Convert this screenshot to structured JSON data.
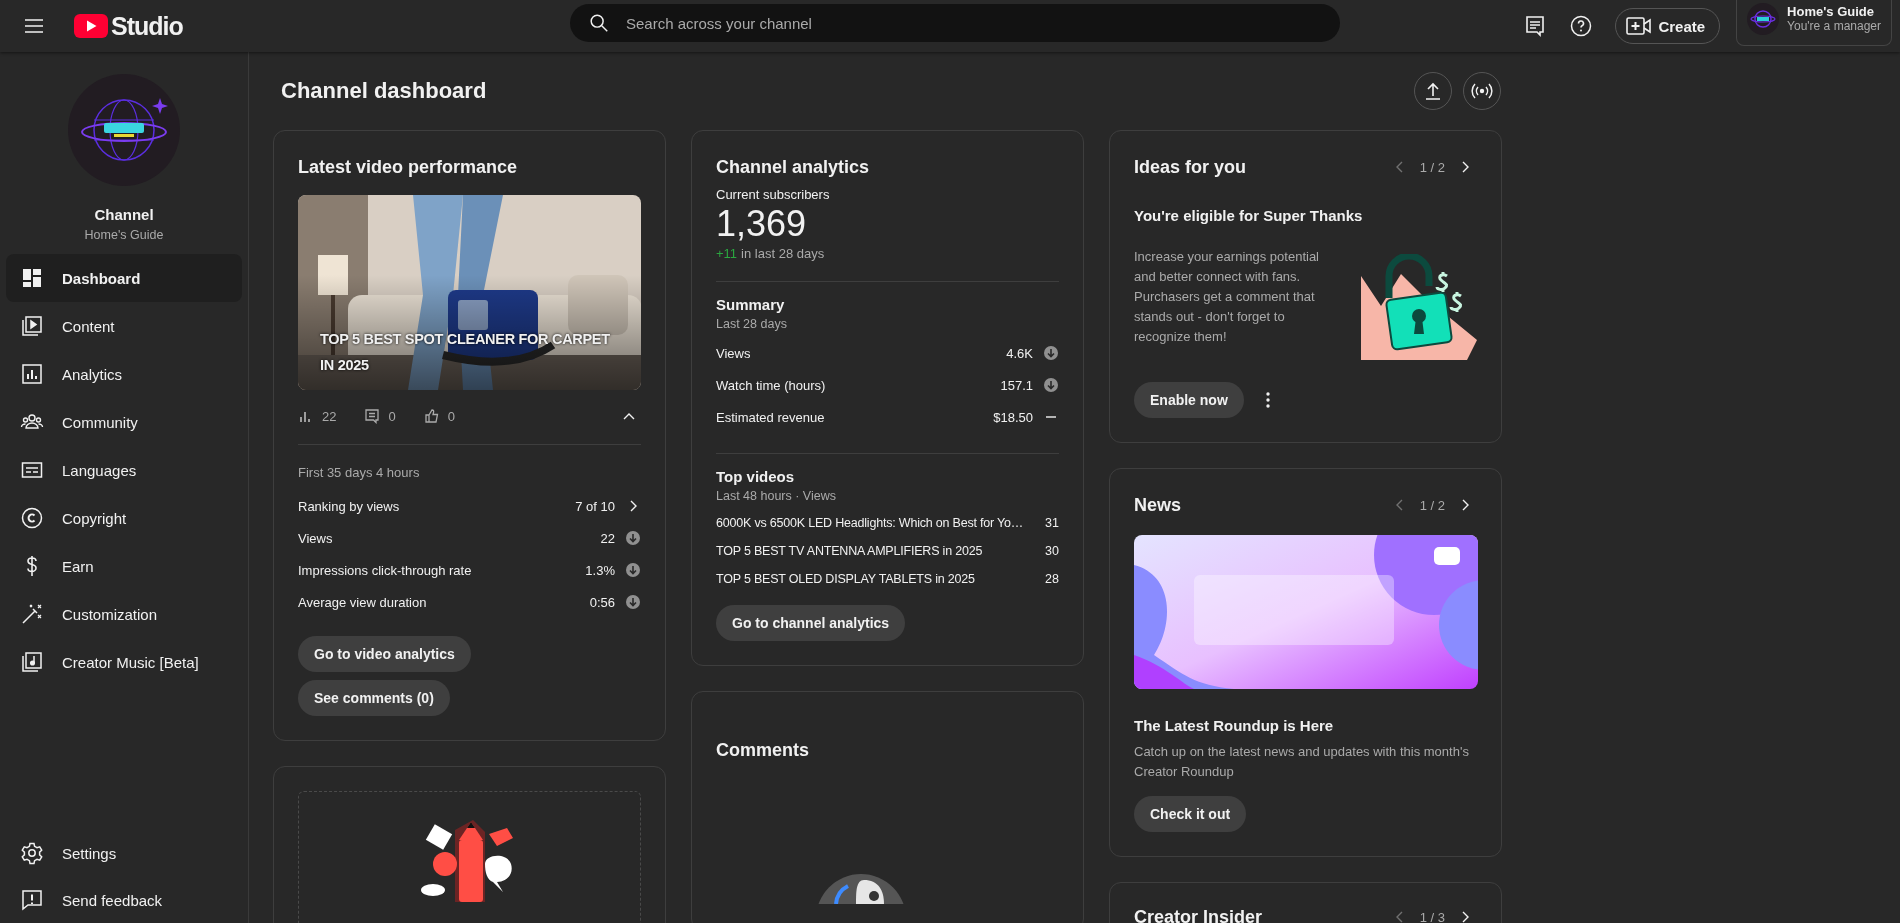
{
  "topbar": {
    "logo": "Studio",
    "search": {
      "placeholder": "Search across your channel"
    },
    "create": "Create",
    "account": {
      "name": "Home's Guide",
      "role": "You're a manager"
    }
  },
  "sidebar": {
    "channel": {
      "label": "Channel",
      "name": "Home's Guide"
    },
    "items": [
      {
        "label": "Dashboard",
        "selected": true
      },
      {
        "label": "Content",
        "selected": false
      },
      {
        "label": "Analytics",
        "selected": false
      },
      {
        "label": "Community",
        "selected": false
      },
      {
        "label": "Languages",
        "selected": false
      },
      {
        "label": "Copyright",
        "selected": false
      },
      {
        "label": "Earn",
        "selected": false
      },
      {
        "label": "Customization",
        "selected": false
      },
      {
        "label": "Creator Music [Beta]",
        "selected": false
      }
    ],
    "footer": [
      {
        "label": "Settings"
      },
      {
        "label": "Send feedback"
      }
    ]
  },
  "page_title": "Channel dashboard",
  "latest_video": {
    "title": "Latest video performance",
    "video_title": "TOP 5 BEST SPOT CLEANER FOR CARPET IN 2025",
    "stats": [
      "22",
      "0",
      "0"
    ],
    "period": "First 35 days 4 hours",
    "rows": [
      {
        "label": "Ranking by views",
        "value": "7 of 10",
        "kind": "link"
      },
      {
        "label": "Views",
        "value": "22",
        "kind": "down"
      },
      {
        "label": "Impressions click-through rate",
        "value": "1.3%",
        "kind": "down"
      },
      {
        "label": "Average view duration",
        "value": "0:56",
        "kind": "down"
      }
    ],
    "buttons": [
      "Go to video analytics",
      "See comments (0)"
    ]
  },
  "analytics": {
    "title": "Channel analytics",
    "subscribers_label": "Current subscribers",
    "subscribers": "1,369",
    "delta": "+11",
    "delta_text": "in last 28 days",
    "summary": {
      "title": "Summary",
      "period": "Last 28 days",
      "rows": [
        {
          "label": "Views",
          "value": "4.6K",
          "kind": "down"
        },
        {
          "label": "Watch time (hours)",
          "value": "157.1",
          "kind": "down"
        },
        {
          "label": "Estimated revenue",
          "value": "$18.50",
          "kind": "flat"
        }
      ]
    },
    "top_videos": {
      "title": "Top videos",
      "period": "Last 48 hours · Views",
      "items": [
        {
          "title": "6000K vs 6500K LED Headlights: Which on Best for Yo…",
          "views": "31"
        },
        {
          "title": "TOP 5 BEST TV ANTENNA AMPLIFIERS in 2025",
          "views": "30"
        },
        {
          "title": "TOP 5 BEST OLED DISPLAY TABLETS in 2025",
          "views": "28"
        }
      ]
    },
    "button": "Go to channel analytics"
  },
  "ideas": {
    "title": "Ideas for you",
    "pager": "1 / 2",
    "heading": "You're eligible for Super Thanks",
    "body": "Increase your earnings potential and better connect with fans. Purchasers get a comment that stands out - don't forget to recognize them!",
    "button": "Enable now"
  },
  "news": {
    "title": "News",
    "pager": "1 / 2",
    "heading": "The Latest Roundup is Here",
    "body": "Catch up on the latest news and updates with this month's Creator Roundup",
    "button": "Check it out"
  },
  "creator_insider": {
    "title": "Creator Insider",
    "pager": "1 / 3"
  },
  "comments": {
    "title": "Comments"
  }
}
